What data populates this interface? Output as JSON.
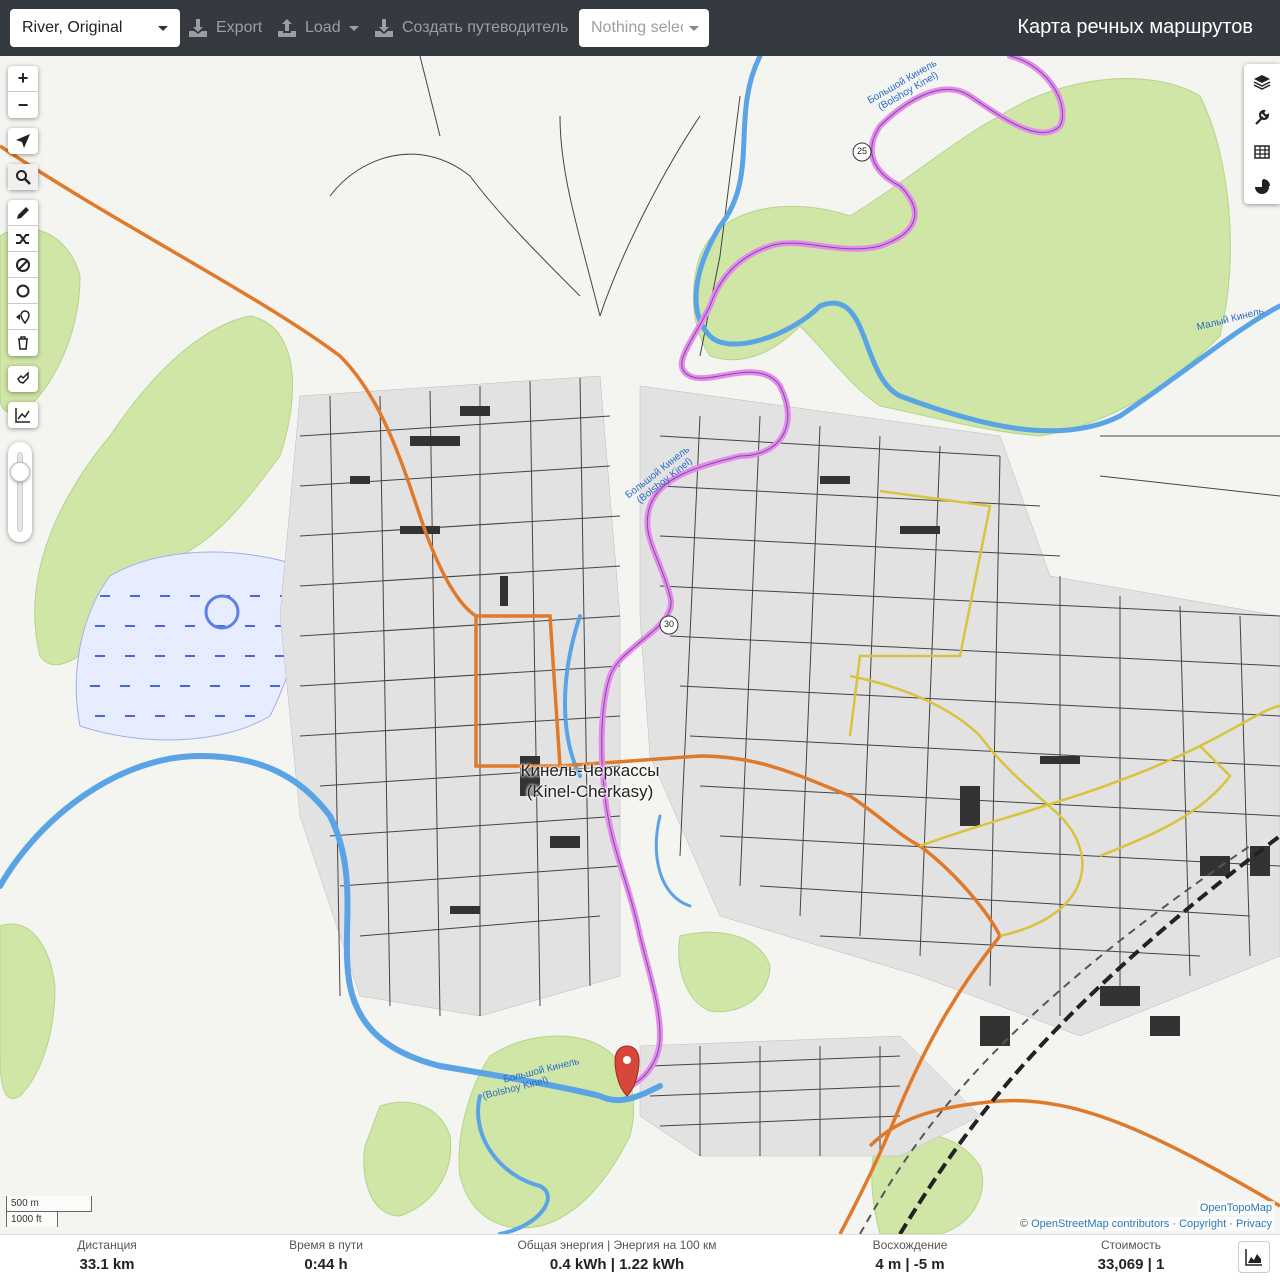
{
  "navbar": {
    "profile": "River, Original",
    "export_label": "Export",
    "load_label": "Load",
    "guide_label": "Создать путеводитель",
    "selection_placeholder": "Nothing selected",
    "title": "Карта речных маршрутов"
  },
  "map": {
    "city_name": "Кинель-Черкассы",
    "city_name_latin": "(Kinel-Cherkasy)",
    "river_labels": [
      "Большой Кинель",
      "(Bolshoy Kinel)",
      "Малый Кинель"
    ],
    "road_shields": [
      "25",
      "30"
    ],
    "colors": {
      "route": "#e58ce8",
      "river": "#5aa4e6",
      "forest": "#cfe6a6",
      "main_road": "#e07a2a",
      "secondary_road": "#d9c33a",
      "marker": "#d9473b"
    }
  },
  "left_toolbar": {
    "zoom_in": "+",
    "zoom_out": "−",
    "tools": [
      "locate-icon",
      "search-icon",
      "draw-icon",
      "reverse-route-icon",
      "no-go-area-icon",
      "circle-icon",
      "delete-last-point-icon",
      "delete-route-icon",
      "stretch-icon",
      "elevation-icon"
    ]
  },
  "right_toolbar": {
    "tools": [
      "layers-icon",
      "settings-icon",
      "table-icon",
      "stats-icon"
    ]
  },
  "scale": {
    "metric": "500 m",
    "imperial": "1000 ft"
  },
  "attribution": {
    "tiles": "OpenTopoMap",
    "prefix": "©",
    "osm": "OpenStreetMap contributors",
    "sep": "·",
    "copyright": "Copyright",
    "privacy": "Privacy"
  },
  "stats": {
    "distance_label": "Дистанция",
    "distance_value": "33.1 km",
    "time_label": "Время в пути",
    "time_value": "0:44 h",
    "energy_label": "Общая энергия | Энергия на 100 км",
    "energy_value": "0.4 kWh | 1.22 kWh",
    "ascent_label": "Восхождение",
    "ascent_value": "4 m | -5 m",
    "cost_label": "Стоимость",
    "cost_value": "33,069 | 1"
  }
}
